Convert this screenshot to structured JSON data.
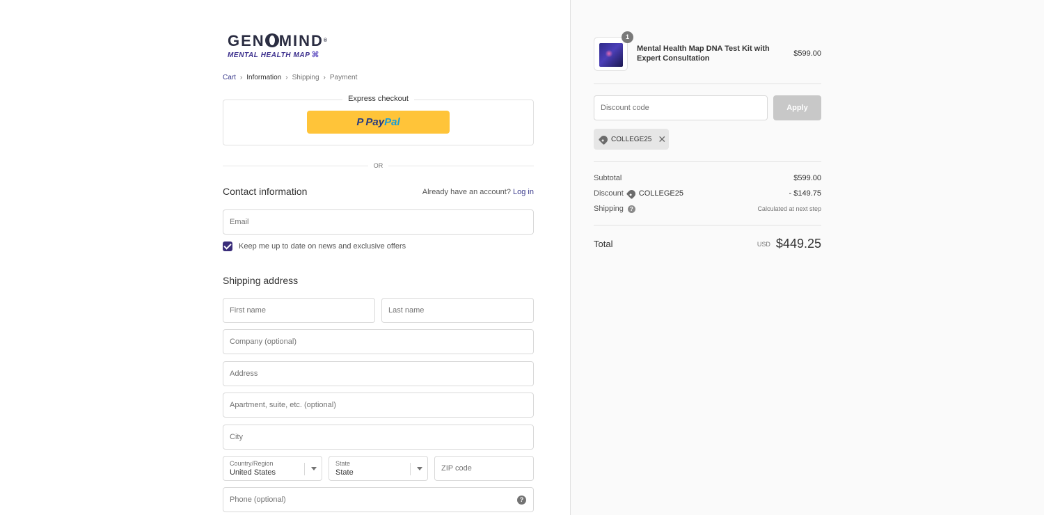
{
  "brand": {
    "name_part1": "GEN",
    "name_part2": "MIND",
    "trademark": "®",
    "tagline": "MENTAL HEALTH MAP"
  },
  "breadcrumb": [
    {
      "label": "Cart"
    },
    {
      "label": "Information"
    },
    {
      "label": "Shipping"
    },
    {
      "label": "Payment"
    }
  ],
  "express": {
    "title": "Express checkout",
    "paypal_pay": "Pay",
    "paypal_pal": "Pal",
    "or_text": "OR"
  },
  "contact": {
    "heading": "Contact information",
    "login_prompt": "Already have an account?",
    "login_link": "Log in",
    "email_placeholder": "Email",
    "newsletter_label": "Keep me up to date on news and exclusive offers"
  },
  "shipping": {
    "heading": "Shipping address",
    "first_name": "First name",
    "last_name": "Last name",
    "company": "Company (optional)",
    "address": "Address",
    "apartment": "Apartment, suite, etc. (optional)",
    "city": "City",
    "country_label": "Country/Region",
    "country_value": "United States",
    "state_label": "State",
    "state_value": "State",
    "zip": "ZIP code",
    "phone": "Phone (optional)"
  },
  "summary": {
    "item": {
      "quantity": "1",
      "name": "Mental Health Map DNA Test Kit with Expert Consultation",
      "price": "$599.00"
    },
    "discount_placeholder": "Discount code",
    "apply_label": "Apply",
    "applied_code": "COLLEGE25",
    "subtotal_label": "Subtotal",
    "subtotal_value": "$599.00",
    "discount_label": "Discount",
    "discount_code": "COLLEGE25",
    "discount_value": "- $149.75",
    "shipping_label": "Shipping",
    "shipping_value": "Calculated at next step",
    "total_label": "Total",
    "currency": "USD",
    "total_value": "$449.25"
  }
}
